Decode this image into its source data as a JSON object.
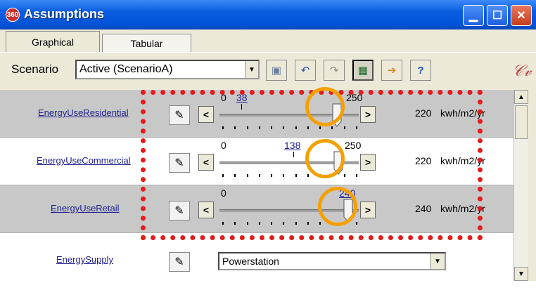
{
  "window": {
    "title": "Assumptions",
    "logo_text": "360",
    "minimize_icon": "minimize-icon",
    "maximize_icon": "maximize-icon",
    "close_icon": "close-icon"
  },
  "tabs": [
    {
      "label": "Graphical",
      "active": true
    },
    {
      "label": "Tabular",
      "active": false
    }
  ],
  "toolbar": {
    "scenario_label": "Scenario",
    "scenario_value": "Active (ScenarioA)",
    "buttons": [
      "save-icon",
      "undo-icon",
      "redo-icon",
      "grid-icon",
      "export-icon",
      "help-icon"
    ],
    "logo_glyph": "𝒞𝓋"
  },
  "rows": [
    {
      "name": "EnergyUseResidential",
      "min": "0",
      "max": "250",
      "current": "38",
      "value": 220,
      "value_text": "220",
      "unit": "kwh/m2/yr"
    },
    {
      "name": "EnergyUseCommercial",
      "min": "0",
      "max": "250",
      "current": "138",
      "value": 220,
      "value_text": "220",
      "unit": "kwh/m2/yr"
    },
    {
      "name": "EnergyUseRetail",
      "min": "0",
      "max": "",
      "current": "240",
      "value": 240,
      "value_text": "240",
      "unit": "kwh/m2/yr"
    },
    {
      "name": "EnergySupply",
      "dropdown": "Powerstation"
    }
  ],
  "colors": {
    "highlight_box": "#e31b1b",
    "highlight_ring": "#f5a000",
    "title_bar": "#0a5ce0"
  }
}
